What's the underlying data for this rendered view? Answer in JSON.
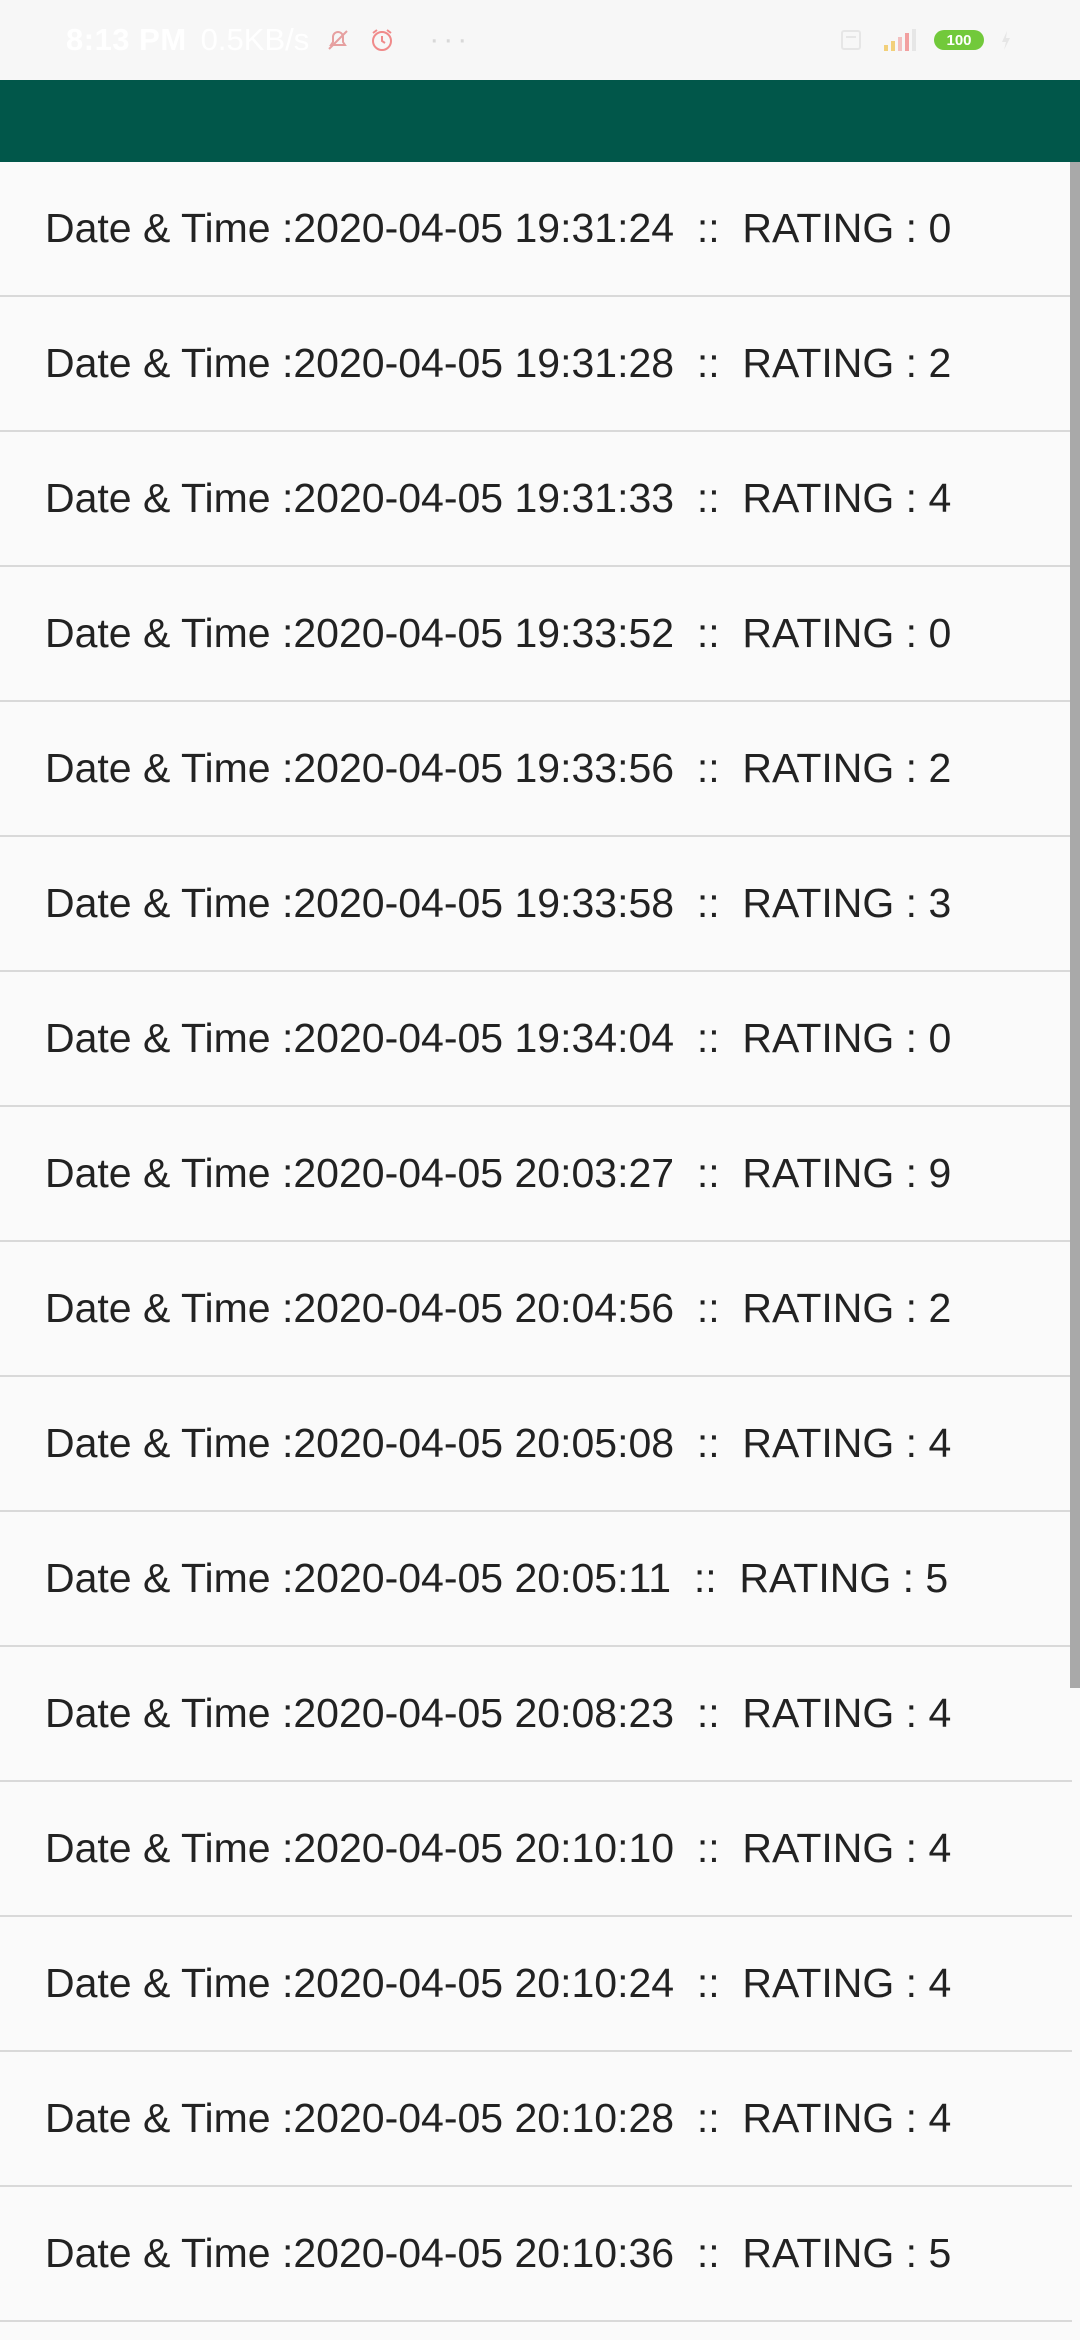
{
  "status_bar": {
    "time": "8:13 PM",
    "network_speed": "0.5KB/s",
    "overflow": "···",
    "battery": "100"
  },
  "list": {
    "items": [
      {
        "text": "Date & Time :2020-04-05 19:31:24  ::  RATING : 0"
      },
      {
        "text": "Date & Time :2020-04-05 19:31:28  ::  RATING : 2"
      },
      {
        "text": "Date & Time :2020-04-05 19:31:33  ::  RATING : 4"
      },
      {
        "text": "Date & Time :2020-04-05 19:33:52  ::  RATING : 0"
      },
      {
        "text": "Date & Time :2020-04-05 19:33:56  ::  RATING : 2"
      },
      {
        "text": "Date & Time :2020-04-05 19:33:58  ::  RATING : 3"
      },
      {
        "text": "Date & Time :2020-04-05 19:34:04  ::  RATING : 0"
      },
      {
        "text": "Date & Time :2020-04-05 20:03:27  ::  RATING : 9"
      },
      {
        "text": "Date & Time :2020-04-05 20:04:56  ::  RATING : 2"
      },
      {
        "text": "Date & Time :2020-04-05 20:05:08  ::  RATING : 4"
      },
      {
        "text": "Date & Time :2020-04-05 20:05:11  ::  RATING : 5"
      },
      {
        "text": "Date & Time :2020-04-05 20:08:23  ::  RATING : 4"
      },
      {
        "text": "Date & Time :2020-04-05 20:10:10  ::  RATING : 4"
      },
      {
        "text": "Date & Time :2020-04-05 20:10:24  ::  RATING : 4"
      },
      {
        "text": "Date & Time :2020-04-05 20:10:28  ::  RATING : 4"
      },
      {
        "text": "Date & Time :2020-04-05 20:10:36  ::  RATING : 5"
      }
    ]
  },
  "colors": {
    "toolbar": "#01574a",
    "background": "#fafafa",
    "divider": "#d9d9d9",
    "text": "#222222",
    "battery": "#72c93b"
  }
}
